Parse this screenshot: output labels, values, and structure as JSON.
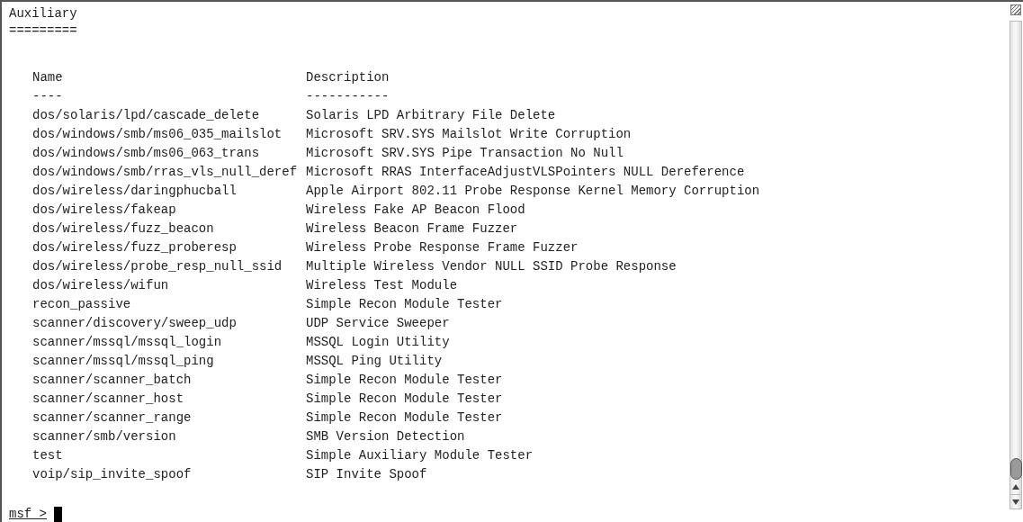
{
  "section": {
    "title": "Auxiliary",
    "underline": "========="
  },
  "table": {
    "columns": [
      {
        "label": "Name",
        "rule": "----"
      },
      {
        "label": "Description",
        "rule": "-----------"
      }
    ],
    "rows": [
      {
        "name": "dos/solaris/lpd/cascade_delete",
        "description": "Solaris LPD Arbitrary File Delete"
      },
      {
        "name": "dos/windows/smb/ms06_035_mailslot",
        "description": "Microsoft SRV.SYS Mailslot Write Corruption"
      },
      {
        "name": "dos/windows/smb/ms06_063_trans",
        "description": "Microsoft SRV.SYS Pipe Transaction No Null"
      },
      {
        "name": "dos/windows/smb/rras_vls_null_deref",
        "description": "Microsoft RRAS InterfaceAdjustVLSPointers NULL Dereference"
      },
      {
        "name": "dos/wireless/daringphucball",
        "description": "Apple Airport 802.11 Probe Response Kernel Memory Corruption"
      },
      {
        "name": "dos/wireless/fakeap",
        "description": "Wireless Fake AP Beacon Flood"
      },
      {
        "name": "dos/wireless/fuzz_beacon",
        "description": "Wireless Beacon Frame Fuzzer"
      },
      {
        "name": "dos/wireless/fuzz_proberesp",
        "description": "Wireless Probe Response Frame Fuzzer"
      },
      {
        "name": "dos/wireless/probe_resp_null_ssid",
        "description": "Multiple Wireless Vendor NULL SSID Probe Response"
      },
      {
        "name": "dos/wireless/wifun",
        "description": "Wireless Test Module"
      },
      {
        "name": "recon_passive",
        "description": "Simple Recon Module Tester"
      },
      {
        "name": "scanner/discovery/sweep_udp",
        "description": "UDP Service Sweeper"
      },
      {
        "name": "scanner/mssql/mssql_login",
        "description": "MSSQL Login Utility"
      },
      {
        "name": "scanner/mssql/mssql_ping",
        "description": "MSSQL Ping Utility"
      },
      {
        "name": "scanner/scanner_batch",
        "description": "Simple Recon Module Tester"
      },
      {
        "name": "scanner/scanner_host",
        "description": "Simple Recon Module Tester"
      },
      {
        "name": "scanner/scanner_range",
        "description": "Simple Recon Module Tester"
      },
      {
        "name": "scanner/smb/version",
        "description": "SMB Version Detection"
      },
      {
        "name": "test",
        "description": "Simple Auxiliary Module Tester"
      },
      {
        "name": "voip/sip_invite_spoof",
        "description": "SIP Invite Spoof"
      }
    ]
  },
  "prompt": "msf >"
}
